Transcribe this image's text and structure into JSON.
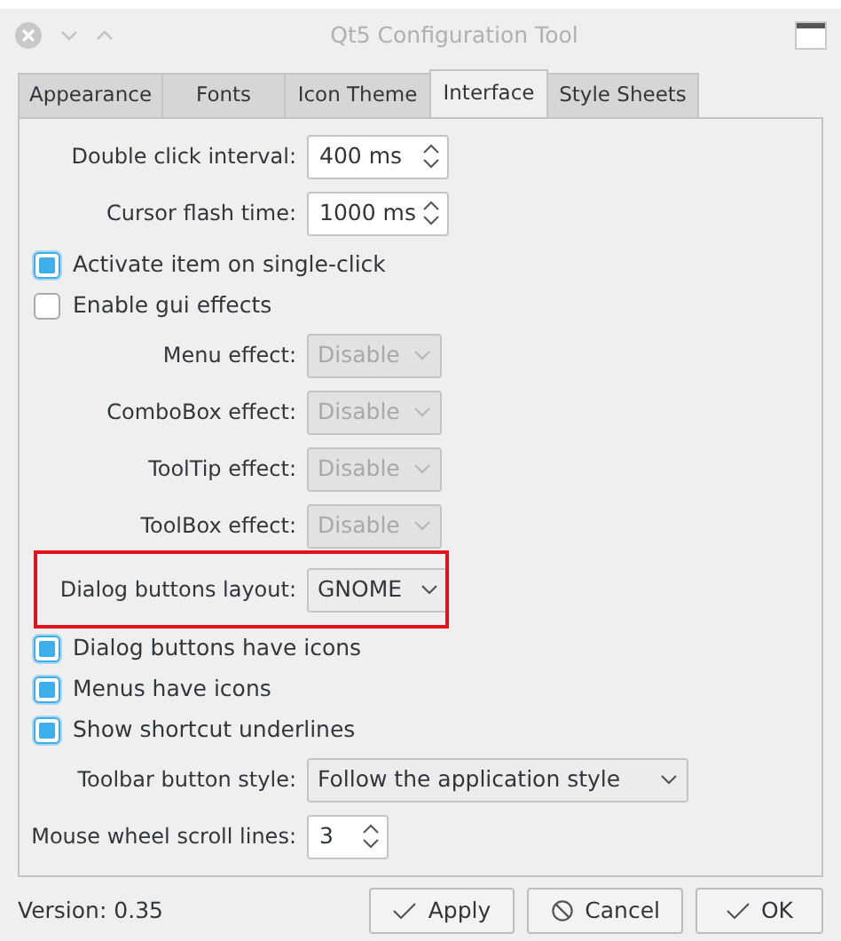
{
  "window": {
    "title": "Qt5 Configuration Tool"
  },
  "tabs": [
    {
      "label": "Appearance",
      "selected": false
    },
    {
      "label": "Fonts",
      "selected": false
    },
    {
      "label": "Icon Theme",
      "selected": false
    },
    {
      "label": "Interface",
      "selected": true
    },
    {
      "label": "Style Sheets",
      "selected": false
    }
  ],
  "rows": [
    {
      "kind": "spin",
      "label": "Double click interval:",
      "value": "400 ms"
    },
    {
      "kind": "spin",
      "label": "Cursor flash time:",
      "value": "1000 ms"
    },
    {
      "kind": "check",
      "label": "Activate item on single-click",
      "checked": true
    },
    {
      "kind": "check",
      "label": "Enable gui effects",
      "checked": false
    },
    {
      "kind": "combo",
      "label": "Menu effect:",
      "value": "Disable",
      "disabled": true,
      "highlighted": false
    },
    {
      "kind": "combo",
      "label": "ComboBox effect:",
      "value": "Disable",
      "disabled": true,
      "highlighted": false
    },
    {
      "kind": "combo",
      "label": "ToolTip effect:",
      "value": "Disable",
      "disabled": true,
      "highlighted": false
    },
    {
      "kind": "combo",
      "label": "ToolBox effect:",
      "value": "Disable",
      "disabled": true,
      "highlighted": false
    },
    {
      "kind": "combo",
      "label": "Dialog buttons layout:",
      "value": "GNOME",
      "disabled": false,
      "highlighted": true
    },
    {
      "kind": "check",
      "label": "Dialog buttons have icons",
      "checked": true
    },
    {
      "kind": "check",
      "label": "Menus have icons",
      "checked": true
    },
    {
      "kind": "check",
      "label": "Show shortcut underlines",
      "checked": true
    },
    {
      "kind": "widecombo",
      "label": "Toolbar button style:",
      "value": "Follow the application style",
      "disabled": false,
      "highlighted": false
    },
    {
      "kind": "spin",
      "label": "Mouse wheel scroll lines:",
      "value": "3"
    }
  ],
  "footer": {
    "version": "Version: 0.35",
    "buttons": [
      {
        "kind": "apply",
        "label": "Apply"
      },
      {
        "kind": "cancel",
        "label": "Cancel"
      },
      {
        "kind": "ok",
        "label": "OK"
      }
    ]
  }
}
